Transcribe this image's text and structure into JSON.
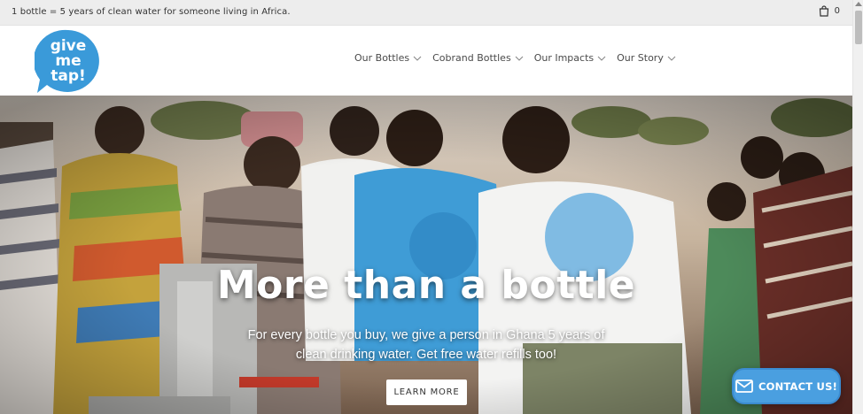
{
  "announcement": {
    "text": "1 bottle = 5 years of clean water for someone living in Africa."
  },
  "cart": {
    "icon": "shopping-bag-icon",
    "count": "0"
  },
  "logo": {
    "line1": "give",
    "line2": "me",
    "line3": "tap!",
    "color": "#3a9ad9"
  },
  "nav": {
    "items": [
      {
        "label": "Our Bottles"
      },
      {
        "label": "Cobrand Bottles"
      },
      {
        "label": "Our Impacts"
      },
      {
        "label": "Our Story"
      }
    ]
  },
  "hero": {
    "title": "More than a bottle",
    "subtitle": "For every bottle you buy, we give a person in Ghana 5 years of clean drinking water. Get free water refills too!",
    "button_label": "LEARN MORE"
  },
  "contact": {
    "label": "CONTACT US!",
    "icon": "envelope-icon",
    "color": "#4a9fe0"
  }
}
